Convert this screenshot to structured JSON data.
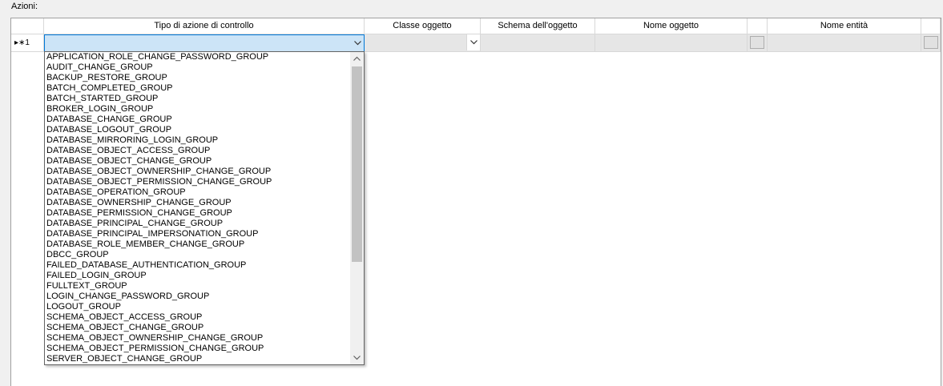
{
  "section_label": "Azioni:",
  "columns": [
    "Tipo di azione di controllo",
    "Classe oggetto",
    "Schema dell'oggetto",
    "Nome oggetto",
    "Nome entità"
  ],
  "row_header": "▸∗1",
  "dropdown_items": [
    "APPLICATION_ROLE_CHANGE_PASSWORD_GROUP",
    "AUDIT_CHANGE_GROUP",
    "BACKUP_RESTORE_GROUP",
    "BATCH_COMPLETED_GROUP",
    "BATCH_STARTED_GROUP",
    "BROKER_LOGIN_GROUP",
    "DATABASE_CHANGE_GROUP",
    "DATABASE_LOGOUT_GROUP",
    "DATABASE_MIRRORING_LOGIN_GROUP",
    "DATABASE_OBJECT_ACCESS_GROUP",
    "DATABASE_OBJECT_CHANGE_GROUP",
    "DATABASE_OBJECT_OWNERSHIP_CHANGE_GROUP",
    "DATABASE_OBJECT_PERMISSION_CHANGE_GROUP",
    "DATABASE_OPERATION_GROUP",
    "DATABASE_OWNERSHIP_CHANGE_GROUP",
    "DATABASE_PERMISSION_CHANGE_GROUP",
    "DATABASE_PRINCIPAL_CHANGE_GROUP",
    "DATABASE_PRINCIPAL_IMPERSONATION_GROUP",
    "DATABASE_ROLE_MEMBER_CHANGE_GROUP",
    "DBCC_GROUP",
    "FAILED_DATABASE_AUTHENTICATION_GROUP",
    "FAILED_LOGIN_GROUP",
    "FULLTEXT_GROUP",
    "LOGIN_CHANGE_PASSWORD_GROUP",
    "LOGOUT_GROUP",
    "SCHEMA_OBJECT_ACCESS_GROUP",
    "SCHEMA_OBJECT_CHANGE_GROUP",
    "SCHEMA_OBJECT_OWNERSHIP_CHANGE_GROUP",
    "SCHEMA_OBJECT_PERMISSION_CHANGE_GROUP",
    "SERVER_OBJECT_CHANGE_GROUP"
  ],
  "icons": {
    "dropdown_arrow": "chevron-down-icon",
    "scroll_up": "chevron-up-icon",
    "scroll_down": "chevron-down-icon"
  },
  "colors": {
    "selected_cell_bg": "#cce4f7",
    "selected_cell_border": "#0078d7",
    "disabled_cell_bg": "#e6e6e6"
  }
}
